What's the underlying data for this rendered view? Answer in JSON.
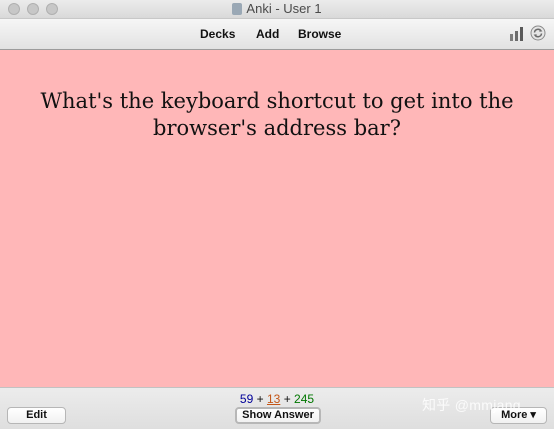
{
  "window": {
    "title": "Anki - User 1"
  },
  "toolbar": {
    "decks_label": "Decks",
    "add_label": "Add",
    "browse_label": "Browse",
    "stats_icon": "stats-icon",
    "sync_icon": "sync-icon"
  },
  "card": {
    "question": "What's the keyboard shortcut to get into the browser's address bar?",
    "background": "#ffb7b8"
  },
  "bottombar": {
    "counts": {
      "new": "59",
      "plus1": "+",
      "learning": "13",
      "plus2": "+",
      "review": "245"
    },
    "edit_label": "Edit",
    "show_answer_label": "Show Answer",
    "more_label": "More",
    "watermark": "知乎 @mmjang"
  },
  "colors": {
    "new_count": "#000099",
    "learning_count": "#c35617",
    "review_count": "#007700"
  }
}
